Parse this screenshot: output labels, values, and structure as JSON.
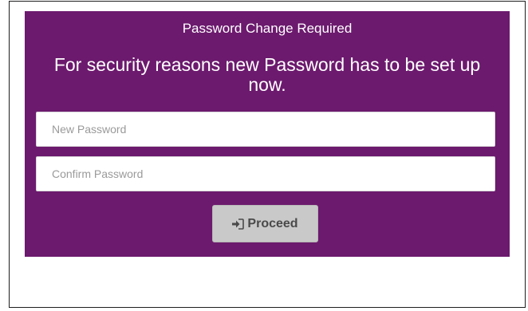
{
  "dialog": {
    "title": "Password Change Required",
    "message": "For security reasons new Password has to be set up now."
  },
  "form": {
    "new_password": {
      "placeholder": "New Password",
      "value": ""
    },
    "confirm_password": {
      "placeholder": "Confirm Password",
      "value": ""
    },
    "proceed_label": "Proceed",
    "proceed_icon": "sign-in-icon"
  },
  "colors": {
    "panel_background": "#6c1a6e",
    "button_background": "#c9c9c9",
    "text_on_panel": "#ffffff"
  }
}
